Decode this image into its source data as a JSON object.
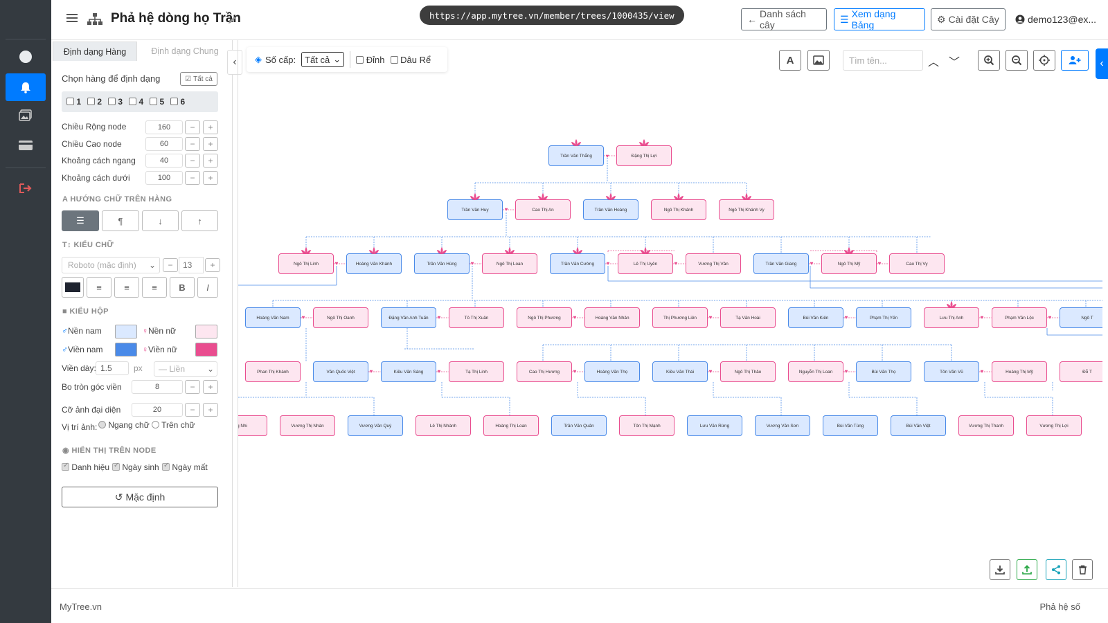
{
  "header": {
    "title": "Phả hệ dòng họ Trần",
    "url": "https://app.mytree.vn/member/trees/1000435/view",
    "btn_list": "Danh sách cây",
    "btn_table": "Xem dạng Bảng",
    "btn_settings": "Cài đặt Cây",
    "user": "demo123@ex..."
  },
  "panel": {
    "tab_row": "Định dạng Hàng",
    "tab_general": "Định dạng Chung",
    "choose_row": "Chọn hàng để định dạng",
    "all_btn": "Tất cả",
    "rows": [
      "1",
      "2",
      "3",
      "4",
      "5",
      "6"
    ],
    "node_width_label": "Chiều Rộng node",
    "node_width": "160",
    "node_height_label": "Chiều Cao node",
    "node_height": "60",
    "h_gap_label": "Khoảng cách ngang",
    "h_gap": "40",
    "v_gap_label": "Khoảng cách dưới",
    "v_gap": "100",
    "sec_text_dir": "HƯỚNG CHỮ TRÊN HÀNG",
    "sec_font": "KIỂU CHỮ",
    "font_family": "Roboto (mặc định)",
    "font_size": "13",
    "sec_box": "KIỂU HỘP",
    "male_bg": "Nền nam",
    "female_bg": "Nền nữ",
    "male_border": "Viền nam",
    "female_border": "Viền nữ",
    "border_width_label": "Viền dày:",
    "border_width": "1.5",
    "border_unit": "px",
    "border_style": "— Liền",
    "radius_label": "Bo tròn góc viền",
    "radius": "8",
    "avatar_label": "Cỡ ảnh đại diện",
    "avatar": "20",
    "img_pos_label": "Vị trí ảnh:",
    "img_pos_1": "Ngang chữ",
    "img_pos_2": "Trên chữ",
    "sec_show": "HIỂN THỊ TRÊN NODE",
    "show_title": "Danh hiệu",
    "show_birth": "Ngày sinh",
    "show_death": "Ngày mất",
    "reset": "Mặc định"
  },
  "toolbar": {
    "levels_label": "Số cấp:",
    "levels_value": "Tất cả",
    "chk_top": "Đỉnh",
    "chk_root": "Dâu Rể",
    "search_placeholder": "Tìm tên..."
  },
  "colors": {
    "male_bg": "#dbe9ff",
    "female_bg": "#fde6f0",
    "male_border": "#4a8ae8",
    "female_border": "#e94d8f",
    "primary": "#007bff"
  },
  "tree": {
    "gen1": [
      "Trần Văn Thắng",
      "Đặng Thị Lợi"
    ],
    "gen2": [
      "Trần Văn Huy",
      "Cao Thị An",
      "Trần Văn Hoàng",
      "Ngô Thị Khánh",
      "Ngô Thị Khánh Vy"
    ],
    "gen3": [
      "Ngô Thị Linh",
      "Hoàng Văn Khánh",
      "Trần Văn Hùng",
      "Ngô Thị Loan",
      "Trần Văn Cường",
      "Lê Thị Uyên",
      "Vương Thị Vân",
      "Trần Văn Giang",
      "Ngô Thị Mỹ",
      "Cao Thị Vy"
    ],
    "gen4": [
      "Hoàng Văn Nam",
      "Ngô Thị Oanh",
      "Đặng Văn Anh Tuấn",
      "Tô Thị Xuân",
      "Ngô Thị Phương",
      "Hoàng Văn Nhân",
      "Thị Phương Liên",
      "Tạ Văn Hoài",
      "Bùi Văn Kiên",
      "Phạm Thị Yến",
      "Lưu Thị Anh",
      "Phạm Văn Lộc",
      "Ngô T"
    ],
    "gen5": [
      "Phan Thị Khánh",
      "Văn Quốc Việt",
      "Kiều Văn Sáng",
      "Tạ Thị Linh",
      "Cao Thị Hương",
      "Hoàng Văn Thọ",
      "Kiều Văn Thái",
      "Ngô Thị Thảo",
      "Nguyễn Thị Loan",
      "Bùi Văn Thọ",
      "Tôn Văn Vũ",
      "Hoàng Thị Mỹ",
      "Đỗ T"
    ],
    "gen6": [
      "ộng Nhi",
      "Vương Thị Nhàn",
      "Vương Văn Quý",
      "Lê Thị Nhành",
      "Hoàng Thị Loan",
      "Trần Văn Quân",
      "Tôn Thị Mạnh",
      "Lưu Văn Rừng",
      "Vương Văn Sơn",
      "Bùi Văn Tùng",
      "Bùi Văn Việt",
      "Vương Thị Thanh",
      "Vương Thị Lợi"
    ]
  },
  "footer": {
    "brand": "MyTree.vn",
    "right": "Phả hệ số"
  }
}
